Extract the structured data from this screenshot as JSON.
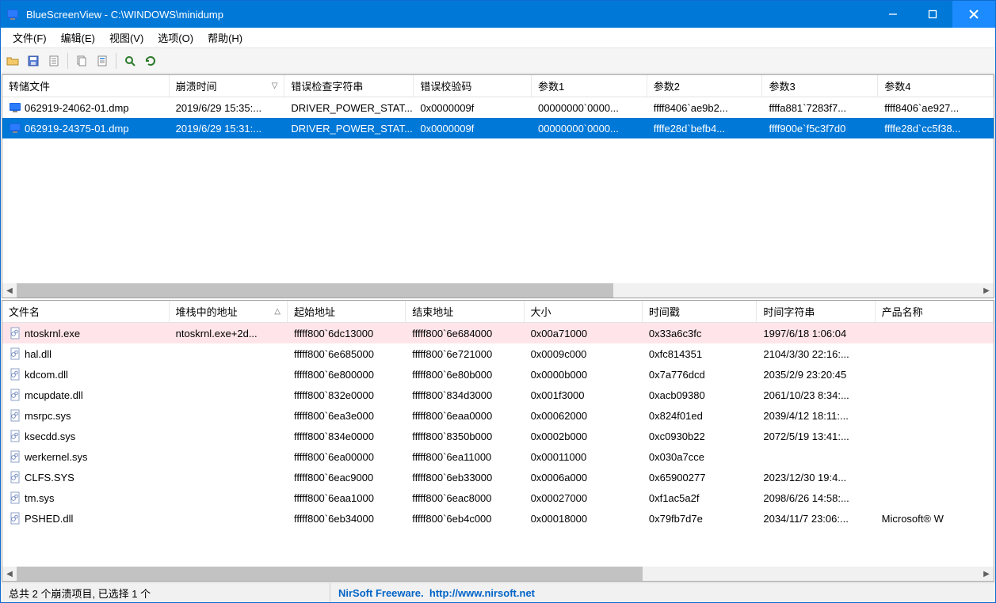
{
  "title": "BlueScreenView  -  C:\\WINDOWS\\minidump",
  "menu": {
    "file": "文件(F)",
    "edit": "编辑(E)",
    "view": "视图(V)",
    "options": "选项(O)",
    "help": "帮助(H)"
  },
  "top_columns": [
    "转储文件",
    "崩溃时间",
    "错误检查字符串",
    "错误校验码",
    "参数1",
    "参数2",
    "参数3",
    "参数4"
  ],
  "top_sort_col": 1,
  "top_rows": [
    {
      "file": "062919-24062-01.dmp",
      "time": "2019/6/29 15:35:...",
      "bugcheck": "DRIVER_POWER_STAT...",
      "code": "0x0000009f",
      "p1": "00000000`0000...",
      "p2": "ffff8406`ae9b2...",
      "p3": "ffffa881`7283f7...",
      "p4": "ffff8406`ae927...",
      "selected": false
    },
    {
      "file": "062919-24375-01.dmp",
      "time": "2019/6/29 15:31:...",
      "bugcheck": "DRIVER_POWER_STAT...",
      "code": "0x0000009f",
      "p1": "00000000`0000...",
      "p2": "ffffe28d`befb4...",
      "p3": "ffff900e`f5c3f7d0",
      "p4": "ffffe28d`cc5f38...",
      "selected": true
    }
  ],
  "bottom_columns": [
    "文件名",
    "堆栈中的地址",
    "起始地址",
    "结束地址",
    "大小",
    "时间戳",
    "时间字符串",
    "产品名称"
  ],
  "bottom_sort_col": 1,
  "bottom_rows": [
    {
      "file": "ntoskrnl.exe",
      "stack": "ntoskrnl.exe+2d...",
      "from": "fffff800`6dc13000",
      "to": "fffff800`6e684000",
      "size": "0x00a71000",
      "ts": "0x33a6c3fc",
      "tstr": "1997/6/18 1:06:04",
      "prod": "",
      "highlight": true
    },
    {
      "file": "hal.dll",
      "stack": "",
      "from": "fffff800`6e685000",
      "to": "fffff800`6e721000",
      "size": "0x0009c000",
      "ts": "0xfc814351",
      "tstr": "2104/3/30 22:16:...",
      "prod": ""
    },
    {
      "file": "kdcom.dll",
      "stack": "",
      "from": "fffff800`6e800000",
      "to": "fffff800`6e80b000",
      "size": "0x0000b000",
      "ts": "0x7a776dcd",
      "tstr": "2035/2/9 23:20:45",
      "prod": ""
    },
    {
      "file": "mcupdate.dll",
      "stack": "",
      "from": "fffff800`832e0000",
      "to": "fffff800`834d3000",
      "size": "0x001f3000",
      "ts": "0xacb09380",
      "tstr": "2061/10/23 8:34:...",
      "prod": ""
    },
    {
      "file": "msrpc.sys",
      "stack": "",
      "from": "fffff800`6ea3e000",
      "to": "fffff800`6eaa0000",
      "size": "0x00062000",
      "ts": "0x824f01ed",
      "tstr": "2039/4/12 18:11:...",
      "prod": ""
    },
    {
      "file": "ksecdd.sys",
      "stack": "",
      "from": "fffff800`834e0000",
      "to": "fffff800`8350b000",
      "size": "0x0002b000",
      "ts": "0xc0930b22",
      "tstr": "2072/5/19 13:41:...",
      "prod": ""
    },
    {
      "file": "werkernel.sys",
      "stack": "",
      "from": "fffff800`6ea00000",
      "to": "fffff800`6ea11000",
      "size": "0x00011000",
      "ts": "0x030a7cce",
      "tstr": "",
      "prod": ""
    },
    {
      "file": "CLFS.SYS",
      "stack": "",
      "from": "fffff800`6eac9000",
      "to": "fffff800`6eb33000",
      "size": "0x0006a000",
      "ts": "0x65900277",
      "tstr": "2023/12/30 19:4...",
      "prod": ""
    },
    {
      "file": "tm.sys",
      "stack": "",
      "from": "fffff800`6eaa1000",
      "to": "fffff800`6eac8000",
      "size": "0x00027000",
      "ts": "0xf1ac5a2f",
      "tstr": "2098/6/26 14:58:...",
      "prod": ""
    },
    {
      "file": "PSHED.dll",
      "stack": "",
      "from": "fffff800`6eb34000",
      "to": "fffff800`6eb4c000",
      "size": "0x00018000",
      "ts": "0x79fb7d7e",
      "tstr": "2034/11/7 23:06:...",
      "prod": "Microsoft® W"
    }
  ],
  "status_left": "总共 2 个崩溃项目, 已选择 1 个",
  "status_brand": "NirSoft Freeware.",
  "status_url": "http://www.nirsoft.net"
}
